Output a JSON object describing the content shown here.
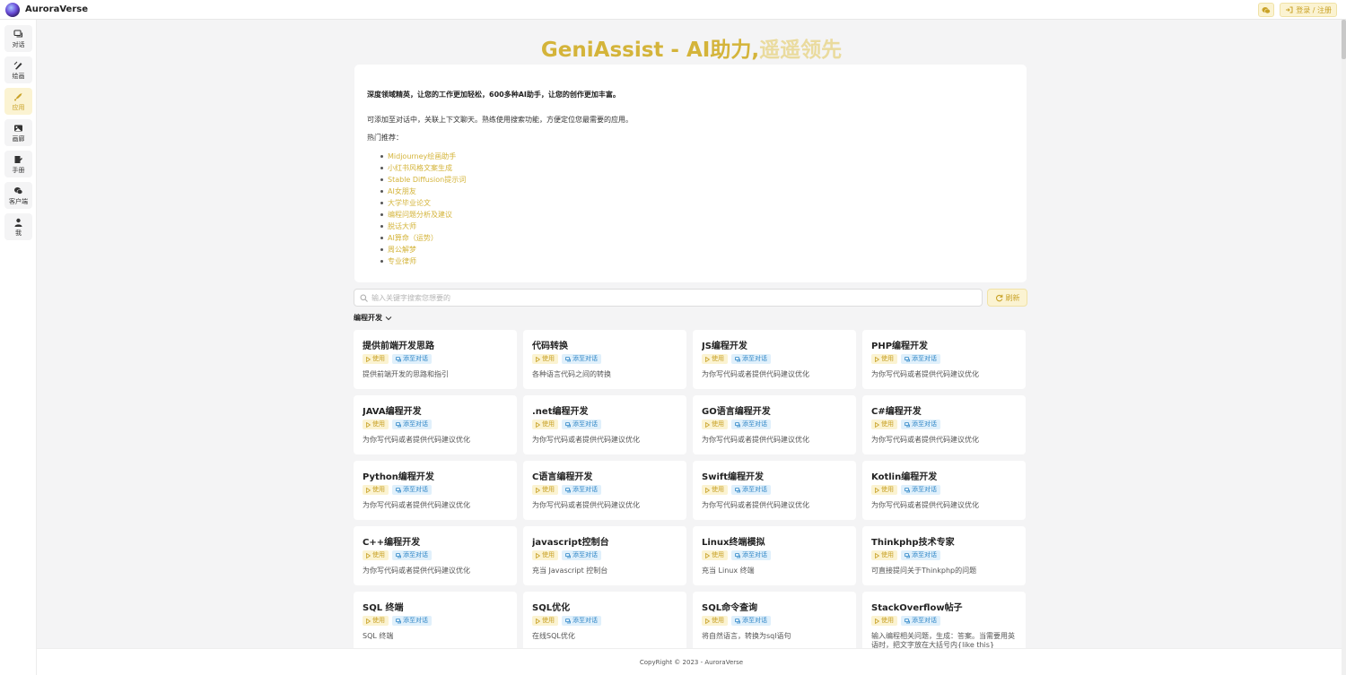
{
  "header": {
    "brand_name": "AuroraVerse",
    "wechat_icon": "wechat-icon",
    "login_label": "登录 / 注册",
    "login_icon": "login-icon"
  },
  "sidebar": {
    "items": [
      {
        "label": "对话",
        "icon": "chat-icon",
        "active": false
      },
      {
        "label": "绘画",
        "icon": "brush-icon",
        "active": false
      },
      {
        "label": "应用",
        "icon": "rocket-icon",
        "active": true
      },
      {
        "label": "画廊",
        "icon": "gallery-icon",
        "active": false
      },
      {
        "label": "手册",
        "icon": "manual-icon",
        "active": false
      },
      {
        "label": "客户端",
        "icon": "client-icon",
        "active": false
      },
      {
        "label": "我",
        "icon": "user-icon",
        "active": false
      }
    ]
  },
  "hero": {
    "title_main": "GeniAssist - AI助力,",
    "title_fade": "遥遥领先"
  },
  "intro": {
    "line1": "深度领域精英，让您的工作更加轻松，600多种AI助手，让您的创作更加丰富。",
    "line2": "可添加至对话中，关联上下文聊天。熟练使用搜索功能，方便定位您最需要的应用。",
    "line3": "热门推荐：",
    "hot": [
      "Midjourney绘画助手",
      "小红书风格文案生成",
      "Stable Diffusion提示词",
      "AI女朋友",
      "大学毕业论文",
      "编程问题分析及建议",
      "脱话大师",
      "AI算命（运势）",
      "周公解梦",
      "专业律师"
    ]
  },
  "search": {
    "placeholder": "输入关键字搜索您想要的",
    "refresh_label": "刷新"
  },
  "category": {
    "label": "编程开发"
  },
  "tags": {
    "use": "使用",
    "add": "添至对话"
  },
  "apps": [
    {
      "title": "提供前端开发思路",
      "desc": "提供前端开发的思路和指引"
    },
    {
      "title": "代码转换",
      "desc": "各种语言代码之间的转换"
    },
    {
      "title": "JS编程开发",
      "desc": "为你写代码或者提供代码建议优化"
    },
    {
      "title": "PHP编程开发",
      "desc": "为你写代码或者提供代码建议优化"
    },
    {
      "title": "JAVA编程开发",
      "desc": "为你写代码或者提供代码建议优化"
    },
    {
      "title": ".net编程开发",
      "desc": "为你写代码或者提供代码建议优化"
    },
    {
      "title": "GO语言编程开发",
      "desc": "为你写代码或者提供代码建议优化"
    },
    {
      "title": "C#编程开发",
      "desc": "为你写代码或者提供代码建议优化"
    },
    {
      "title": "Python编程开发",
      "desc": "为你写代码或者提供代码建议优化"
    },
    {
      "title": "C语言编程开发",
      "desc": "为你写代码或者提供代码建议优化"
    },
    {
      "title": "Swift编程开发",
      "desc": "为你写代码或者提供代码建议优化"
    },
    {
      "title": "Kotlin编程开发",
      "desc": "为你写代码或者提供代码建议优化"
    },
    {
      "title": "C++编程开发",
      "desc": "为你写代码或者提供代码建议优化"
    },
    {
      "title": "javascript控制台",
      "desc": "充当 Javascript 控制台"
    },
    {
      "title": "Linux终端模拟",
      "desc": "充当 Linux 终端"
    },
    {
      "title": "Thinkphp技术专家",
      "desc": "可直接提问关于Thinkphp的问题"
    },
    {
      "title": "SQL 终端",
      "desc": "SQL 终端"
    },
    {
      "title": "SQL优化",
      "desc": "在线SQL优化"
    },
    {
      "title": "SQL命令查询",
      "desc": "将自然语言，转换为sql语句"
    },
    {
      "title": "StackOverflow帖子",
      "desc": "输入编程相关问题，生成：答案。当需要用英语时，把文字放在大括号内{like this}"
    }
  ],
  "footer": {
    "text": "CopyRight © 2023 - AuroraVerse"
  },
  "colors": {
    "accent": "#d4b43a",
    "accent_bg": "#fbf3d2",
    "add_blue": "#2f86c7"
  }
}
